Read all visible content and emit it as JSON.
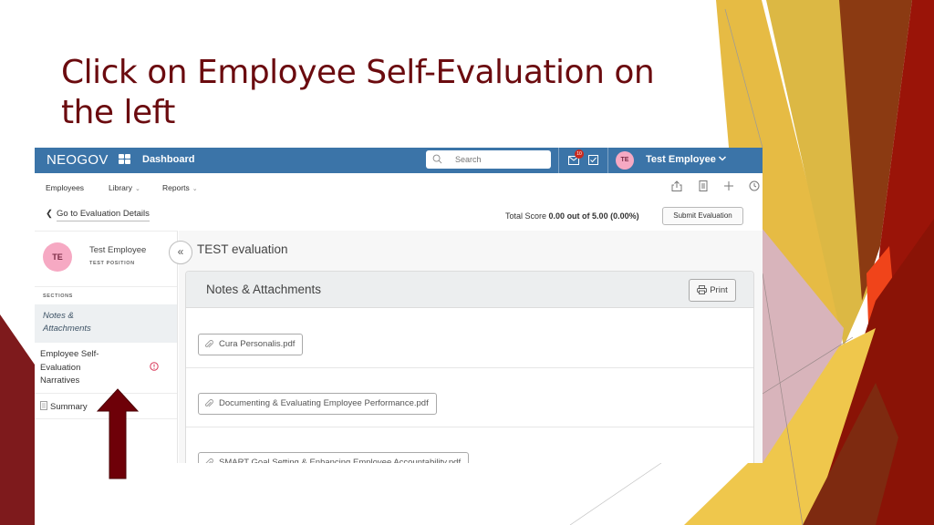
{
  "slide": {
    "title": "Click on Employee Self-Evaluation on the left",
    "accent_color": "#6b0b0f"
  },
  "app": {
    "brand": "NEOGOV",
    "nav_label": "Dashboard",
    "search": {
      "placeholder": "Search",
      "value": ""
    },
    "notification_count": "10",
    "user": {
      "initials": "TE",
      "name": "Test Employee"
    },
    "subnav": [
      {
        "label": "Employees",
        "has_dropdown": false
      },
      {
        "label": "Library",
        "has_dropdown": true
      },
      {
        "label": "Reports",
        "has_dropdown": true
      }
    ],
    "toolbar_icons": [
      "share-icon",
      "document-icon",
      "plus-icon",
      "history-icon"
    ],
    "back_link": "Go to Evaluation Details",
    "score": {
      "prefix": "Total Score",
      "value": "0.00 out of 5.00 (0.00%)"
    },
    "submit_label": "Submit Evaluation",
    "header_color": "#3b74a8"
  },
  "sidebar": {
    "employee": {
      "initials": "TE",
      "name": "Test Employee",
      "position": "TEST POSITION"
    },
    "sections_label": "SECTIONS",
    "items": [
      {
        "label": "Notes & Attachments",
        "active": true
      },
      {
        "label": "Employee Self-Evaluation Narratives",
        "active": false,
        "alert": true
      },
      {
        "label": "Summary",
        "active": false,
        "icon": "document-icon"
      }
    ],
    "collapse_label": "«"
  },
  "main": {
    "eval_title": "TEST evaluation",
    "card_title": "Notes & Attachments",
    "print_label": "Print",
    "attachments": [
      "Cura Personalis.pdf",
      "Documenting & Evaluating Employee Performance.pdf",
      "SMART Goal Setting & Enhancing Employee Accountability.pdf"
    ]
  }
}
